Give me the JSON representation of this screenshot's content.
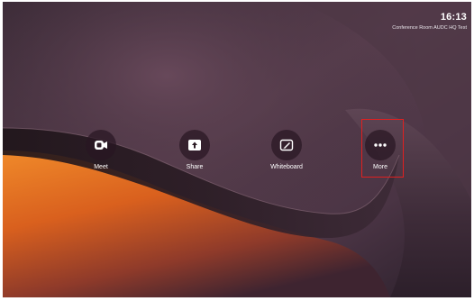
{
  "status": {
    "time": "16:13",
    "room_name": "Conference Room AUDC HQ Test"
  },
  "actions": [
    {
      "label": "Meet",
      "icon": "video-camera-icon"
    },
    {
      "label": "Share",
      "icon": "upload-share-icon"
    },
    {
      "label": "Whiteboard",
      "icon": "whiteboard-pen-icon"
    },
    {
      "label": "More",
      "icon": "more-dots-icon"
    }
  ],
  "colors": {
    "highlight": "#e02020",
    "wallpaper_dark": "#3a2a36",
    "wallpaper_orange": "#e2701c"
  }
}
